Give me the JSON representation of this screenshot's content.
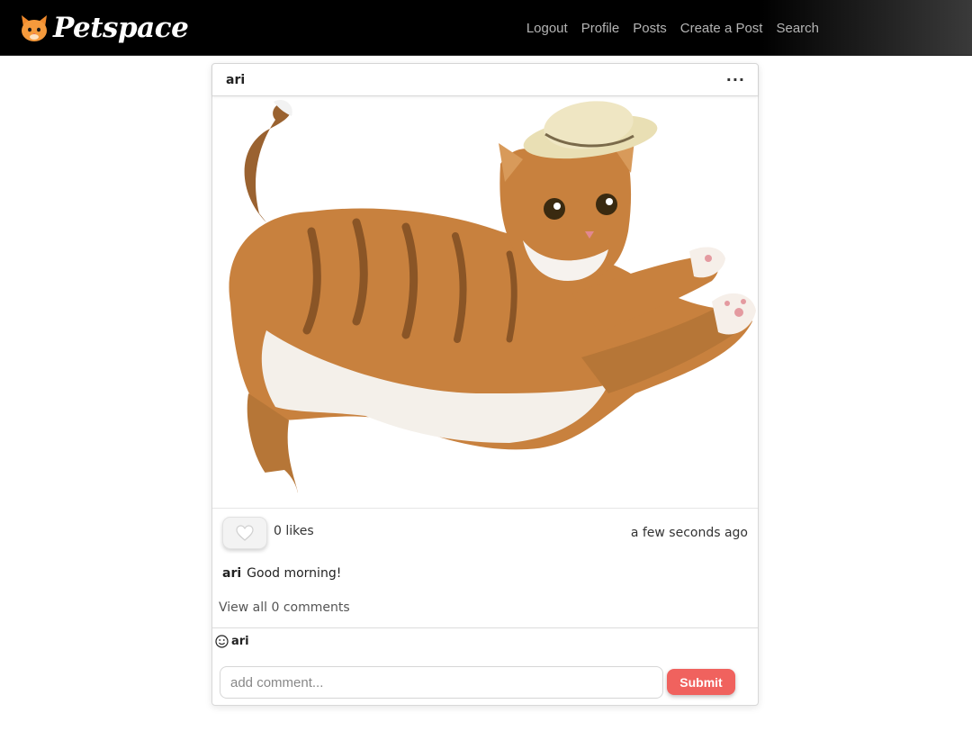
{
  "app": {
    "brand": "Petspace",
    "logo_icon": "cat-face-icon"
  },
  "nav": {
    "links": [
      {
        "label": "Logout"
      },
      {
        "label": "Profile"
      },
      {
        "label": "Posts"
      },
      {
        "label": "Create a Post"
      },
      {
        "label": "Search"
      }
    ]
  },
  "post": {
    "author": "ari",
    "menu_icon": "more-options-icon",
    "image_icon": "cat-photo",
    "like_icon": "heart-icon",
    "likes_text": "0 likes",
    "timestamp": "a few seconds ago",
    "caption_author": "ari",
    "caption_text": "Good morning!",
    "view_comments": "View all 0 comments"
  },
  "comment_box": {
    "user_icon": "smiley-icon",
    "user": "ari",
    "placeholder": "add comment...",
    "value": "",
    "submit_label": "Submit"
  },
  "colors": {
    "navbar_bg": "#000000",
    "nav_link": "#b4b4b4",
    "submit_bg": "#f0625e",
    "cat_fur": "#c8813e"
  }
}
